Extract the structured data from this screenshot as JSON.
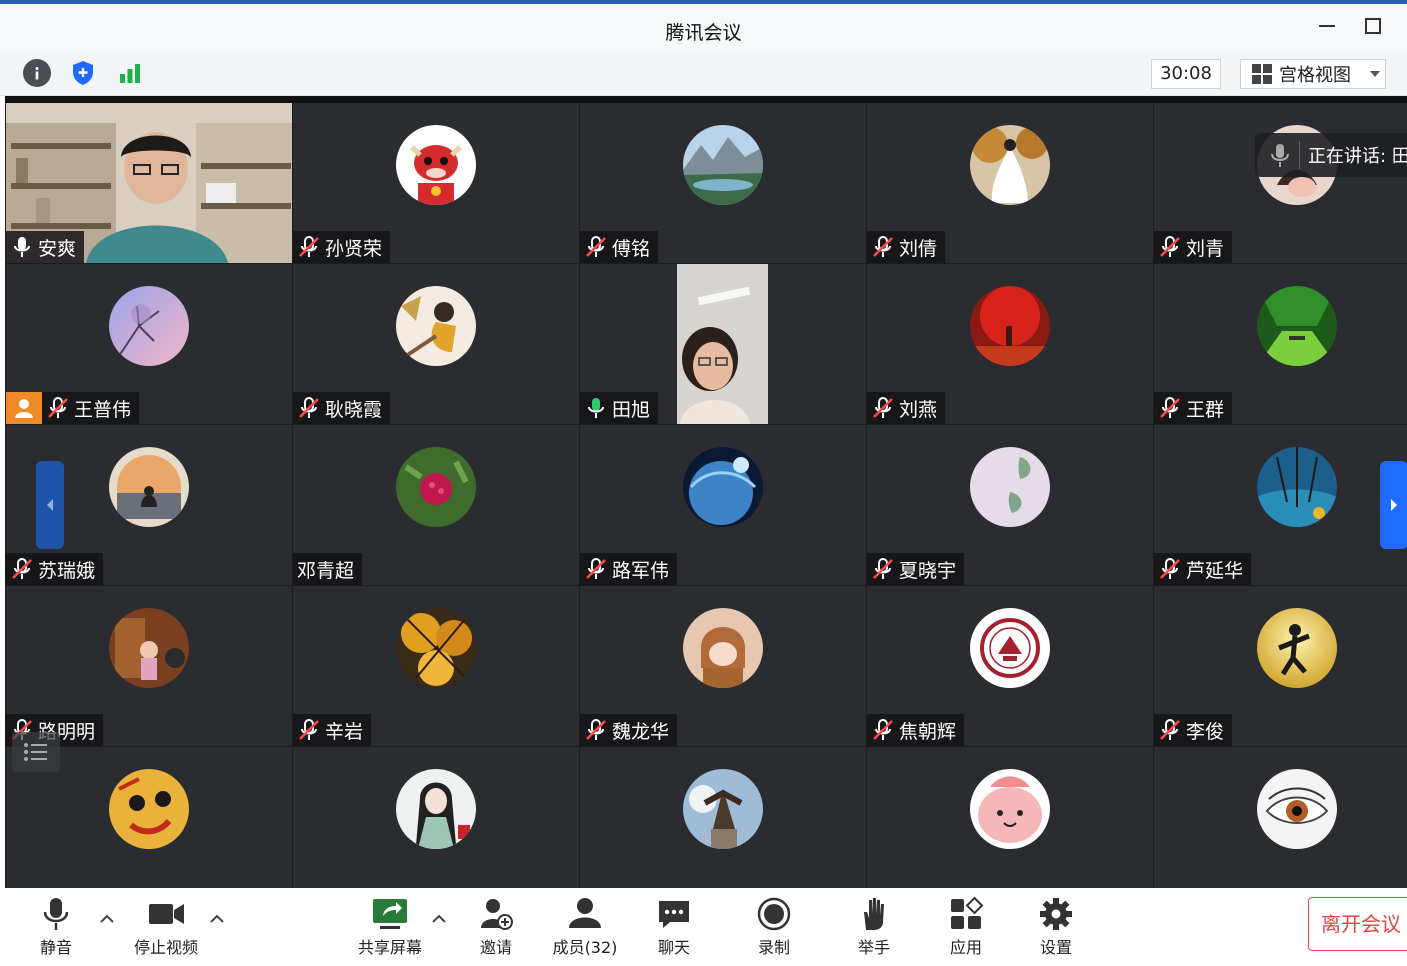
{
  "window": {
    "title": "腾讯会议"
  },
  "toolbar": {
    "timer": "30:08",
    "view_mode": "宫格视图"
  },
  "speaking_label": "正在讲话: 田",
  "participants": [
    {
      "name": "安爽",
      "mic": "on",
      "video": true
    },
    {
      "name": "孙贤荣",
      "mic": "muted"
    },
    {
      "name": "傅铭",
      "mic": "muted"
    },
    {
      "name": "刘倩",
      "mic": "muted"
    },
    {
      "name": "刘青",
      "mic": "muted"
    },
    {
      "name": "王普伟",
      "mic": "muted",
      "badge": "host"
    },
    {
      "name": "耿晓霞",
      "mic": "muted"
    },
    {
      "name": "田旭",
      "mic": "speaking",
      "video": true
    },
    {
      "name": "刘燕",
      "mic": "muted"
    },
    {
      "name": "王群",
      "mic": "muted"
    },
    {
      "name": "苏瑞娥",
      "mic": "muted"
    },
    {
      "name": "邓青超",
      "mic": "none"
    },
    {
      "name": "路军伟",
      "mic": "muted"
    },
    {
      "name": "夏晓宇",
      "mic": "muted"
    },
    {
      "name": "芦延华",
      "mic": "muted"
    },
    {
      "name": "路明明",
      "mic": "muted"
    },
    {
      "name": "辛岩",
      "mic": "muted"
    },
    {
      "name": "魏龙华",
      "mic": "muted"
    },
    {
      "name": "焦朝辉",
      "mic": "muted"
    },
    {
      "name": "李俊",
      "mic": "muted"
    }
  ],
  "bottombar": {
    "mute": "静音",
    "stop_video": "停止视频",
    "share": "共享屏幕",
    "invite": "邀请",
    "members": "成员(32)",
    "chat": "聊天",
    "record": "录制",
    "raise_hand": "举手",
    "apps": "应用",
    "settings": "设置",
    "leave": "离开会议"
  },
  "colors": {
    "accent": "#1f6bff",
    "leave": "#e34545",
    "speaking": "#2ecc71",
    "host_badge": "#f08a24"
  }
}
